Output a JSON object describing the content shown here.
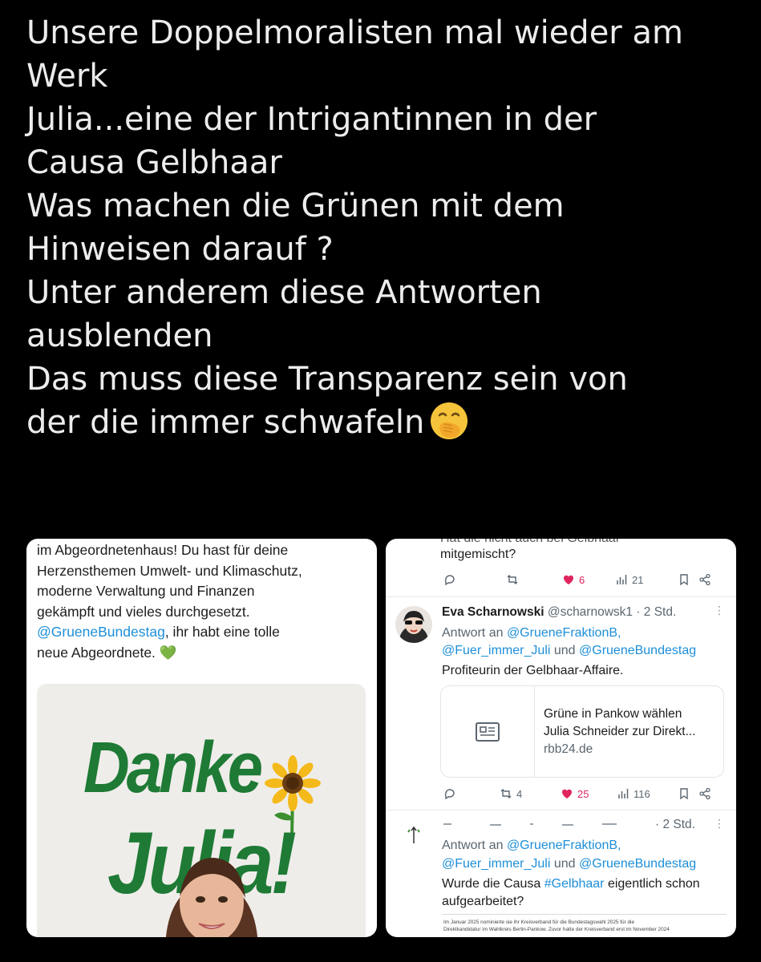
{
  "post": {
    "lines": [
      "Unsere Doppelmoralisten mal wieder am",
      "Werk",
      "Julia...eine der Intrigantinnen in der",
      "Causa Gelbhaar",
      "Was machen die Grünen mit dem",
      "Hinweisen darauf ?",
      "Unter anderem diese Antworten",
      "ausblenden",
      "Das muss diese Transparenz sein von",
      "der die immer schwafeln"
    ],
    "emoji": "face-with-hand-over-mouth"
  },
  "left_screenshot": {
    "line1": "im Abgeordnetenhaus! Du hast für deine",
    "line2": "Herzensthemen Umwelt- und Klimaschutz,",
    "line3": "moderne Verwaltung und Finanzen",
    "line4": "gekämpft und vieles durchgesetzt.",
    "mention": "@GrueneBundestag",
    "line5_rest": ", ihr habt eine tolle",
    "line6": "neue Abgeordnete.",
    "heart": "💚",
    "image": {
      "word1": "Danke",
      "word2": "Julia!"
    }
  },
  "right_screenshot": {
    "top_partial": "Hat die nicht auch bei Gelbhaar",
    "top_line": "mitgemischt?",
    "actions1": {
      "replies": "",
      "reposts": "",
      "likes": "6",
      "views": "21"
    },
    "reply1": {
      "name": "Eva Scharnowski",
      "handle_time": "@scharnowsk1 · 2 Std.",
      "reply_to_label": "Antwort an",
      "reply_to_1": "@GrueneFraktionB,",
      "reply_to_2": "@Fuer_immer_Juli",
      "reply_to_and": "und",
      "reply_to_3": "@GrueneBundestag",
      "text": "Profiteurin der Gelbhaar-Affaire.",
      "link_title_1": "Grüne in Pankow wählen",
      "link_title_2": "Julia Schneider zur Direkt...",
      "link_domain": "rbb24.de"
    },
    "actions2": {
      "replies": "",
      "reposts": "4",
      "likes": "25",
      "views": "116"
    },
    "reply2": {
      "time": "· 2 Std.",
      "reply_to_label": "Antwort an",
      "reply_to_1": "@GrueneFraktionB,",
      "reply_to_2": "@Fuer_immer_Juli",
      "reply_to_and": "und",
      "reply_to_3": "@GrueneBundestag",
      "text_1": "Wurde die Causa",
      "hashtag": "#Gelbhaar",
      "text_2": "eigentlich schon",
      "text_3": "aufgearbeitet?",
      "snippet_1": "Im Januar 2025 nominierte sie ihr Kreisverband für die Bundestagswahl 2025 für die",
      "snippet_2": "Direktkandidatur im Wahlkreis Berlin-Pankow. Zuvor hatte der Kreisverband erst im November 2024"
    }
  },
  "colors": {
    "background": "#000000",
    "post_text": "#ececec",
    "mention": "#1d8fd8",
    "like_pink": "#e0245e",
    "danke_green": "#1e7a35"
  }
}
